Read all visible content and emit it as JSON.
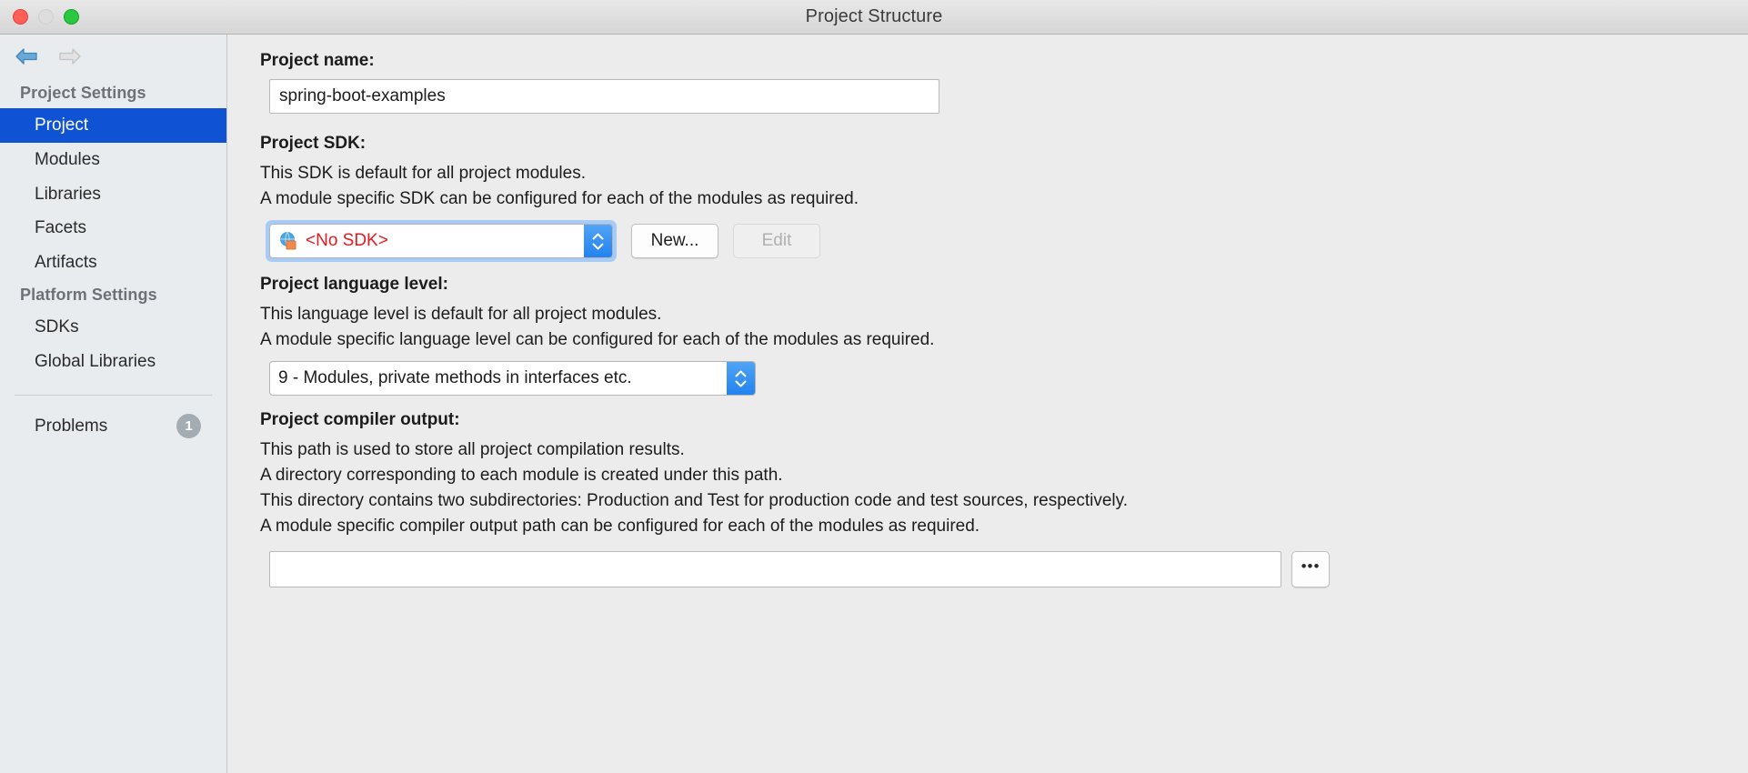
{
  "window": {
    "title": "Project Structure",
    "traffic_lights": [
      "close-button",
      "minimize-button",
      "maximize-button"
    ]
  },
  "nav": {
    "back_icon": "arrow-left-icon",
    "forward_icon": "arrow-right-icon",
    "back_enabled": true,
    "forward_enabled": false
  },
  "sidebar": {
    "groups": [
      {
        "header": "Project Settings",
        "items": [
          {
            "label": "Project",
            "selected": true
          },
          {
            "label": "Modules",
            "selected": false
          },
          {
            "label": "Libraries",
            "selected": false
          },
          {
            "label": "Facets",
            "selected": false
          },
          {
            "label": "Artifacts",
            "selected": false
          }
        ]
      },
      {
        "header": "Platform Settings",
        "items": [
          {
            "label": "SDKs",
            "selected": false
          },
          {
            "label": "Global Libraries",
            "selected": false
          }
        ]
      }
    ],
    "problems": {
      "label": "Problems",
      "count": "1"
    }
  },
  "main": {
    "project_name": {
      "label": "Project name:",
      "value": "spring-boot-examples",
      "placeholder": ""
    },
    "project_sdk": {
      "label": "Project SDK:",
      "description_lines": [
        "This SDK is default for all project modules.",
        "A module specific SDK can be configured for each of the modules as required."
      ],
      "selected": "<No SDK>",
      "icon": "sdk-globe-icon",
      "new_button": "New...",
      "edit_button": "Edit",
      "edit_enabled": false
    },
    "project_language_level": {
      "label": "Project language level:",
      "description_lines": [
        "This language level is default for all project modules.",
        "A module specific language level can be configured for each of the modules as required."
      ],
      "selected": "9 - Modules, private methods in interfaces etc."
    },
    "project_compiler_output": {
      "label": "Project compiler output:",
      "description_lines": [
        "This path is used to store all project compilation results.",
        "A directory corresponding to each module is created under this path.",
        "This directory contains two subdirectories: Production and Test for production code and test sources, respectively.",
        "A module specific compiler output path can be configured for each of the modules as required."
      ],
      "value": "",
      "placeholder": "",
      "browse_button": "•••"
    }
  },
  "colors": {
    "selection_blue": "#0f53d4",
    "error_red": "#e01b24",
    "stepper_blue": "#2383ee",
    "badge_gray": "#a4acb3",
    "window_bg": "#ececec",
    "sidebar_bg": "#e8ecee"
  }
}
